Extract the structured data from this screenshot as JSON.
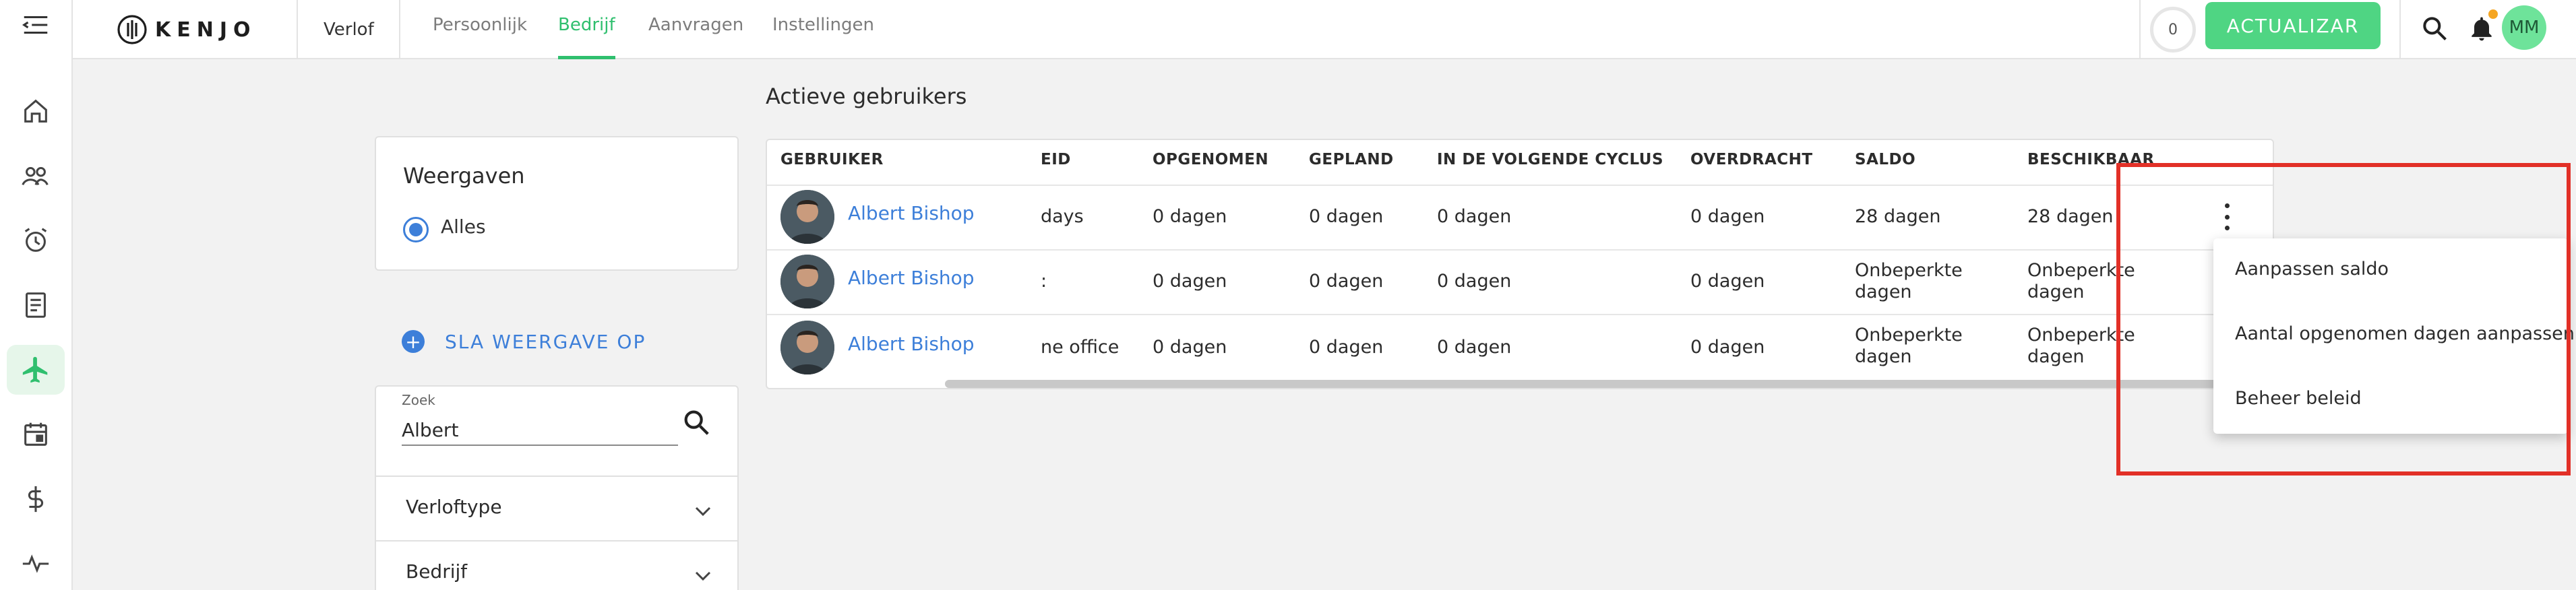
{
  "app": {
    "brand": "KENJO",
    "module": "Verlof",
    "brand_color": "#2fbf6e",
    "accent_color": "#3d7fd9"
  },
  "topnav": {
    "tabs": [
      {
        "label": "Persoonlijk",
        "active": false
      },
      {
        "label": "Bedrijf",
        "active": true
      },
      {
        "label": "Aanvragen",
        "active": false
      },
      {
        "label": "Instellingen",
        "active": false
      }
    ],
    "counter": "0",
    "update_button": "ACTUALIZAR",
    "user_initials": "MM"
  },
  "sidebar": {
    "icons": [
      "menu-collapse-icon",
      "home-icon",
      "people-icon",
      "alarm-icon",
      "document-icon",
      "airplane-icon",
      "calendar-icon",
      "dollar-icon",
      "pulse-icon"
    ],
    "active": "airplane-icon"
  },
  "views": {
    "title": "Weergaven",
    "option": "Alles",
    "save_view": "SLA WEERGAVE OP"
  },
  "search": {
    "label": "Zoek",
    "value": "Albert"
  },
  "filters": [
    "Verloftype",
    "Bedrijf"
  ],
  "table": {
    "title": "Actieve gebruikers",
    "columns": [
      "GEBRUIKER",
      "EID",
      "OPGENOMEN",
      "GEPLAND",
      "IN DE VOLGENDE CYCLUS",
      "OVERDRACHT",
      "SALDO",
      "BESCHIKBAAR"
    ],
    "rows": [
      {
        "user": "Albert Bishop",
        "policy": "days",
        "taken": "0 dagen",
        "planned": "0 dagen",
        "next_cycle": "0 dagen",
        "carryover": "0 dagen",
        "balance": "28 dagen",
        "available": "28 dagen"
      },
      {
        "user": "Albert Bishop",
        "policy": ":",
        "taken": "0 dagen",
        "planned": "0 dagen",
        "next_cycle": "0 dagen",
        "carryover": "0 dagen",
        "balance": "Onbeperkte dagen",
        "available": "Onbeperkte dagen"
      },
      {
        "user": "Albert Bishop",
        "policy": "ne office",
        "taken": "0 dagen",
        "planned": "0 dagen",
        "next_cycle": "0 dagen",
        "carryover": "0 dagen",
        "balance": "Onbeperkte dagen",
        "available": "Onbeperkte dagen"
      }
    ]
  },
  "context_menu": {
    "items": [
      "Aanpassen saldo",
      "Aantal opgenomen dagen aanpassen",
      "Beheer beleid"
    ]
  },
  "highlight_color": "#e23027"
}
